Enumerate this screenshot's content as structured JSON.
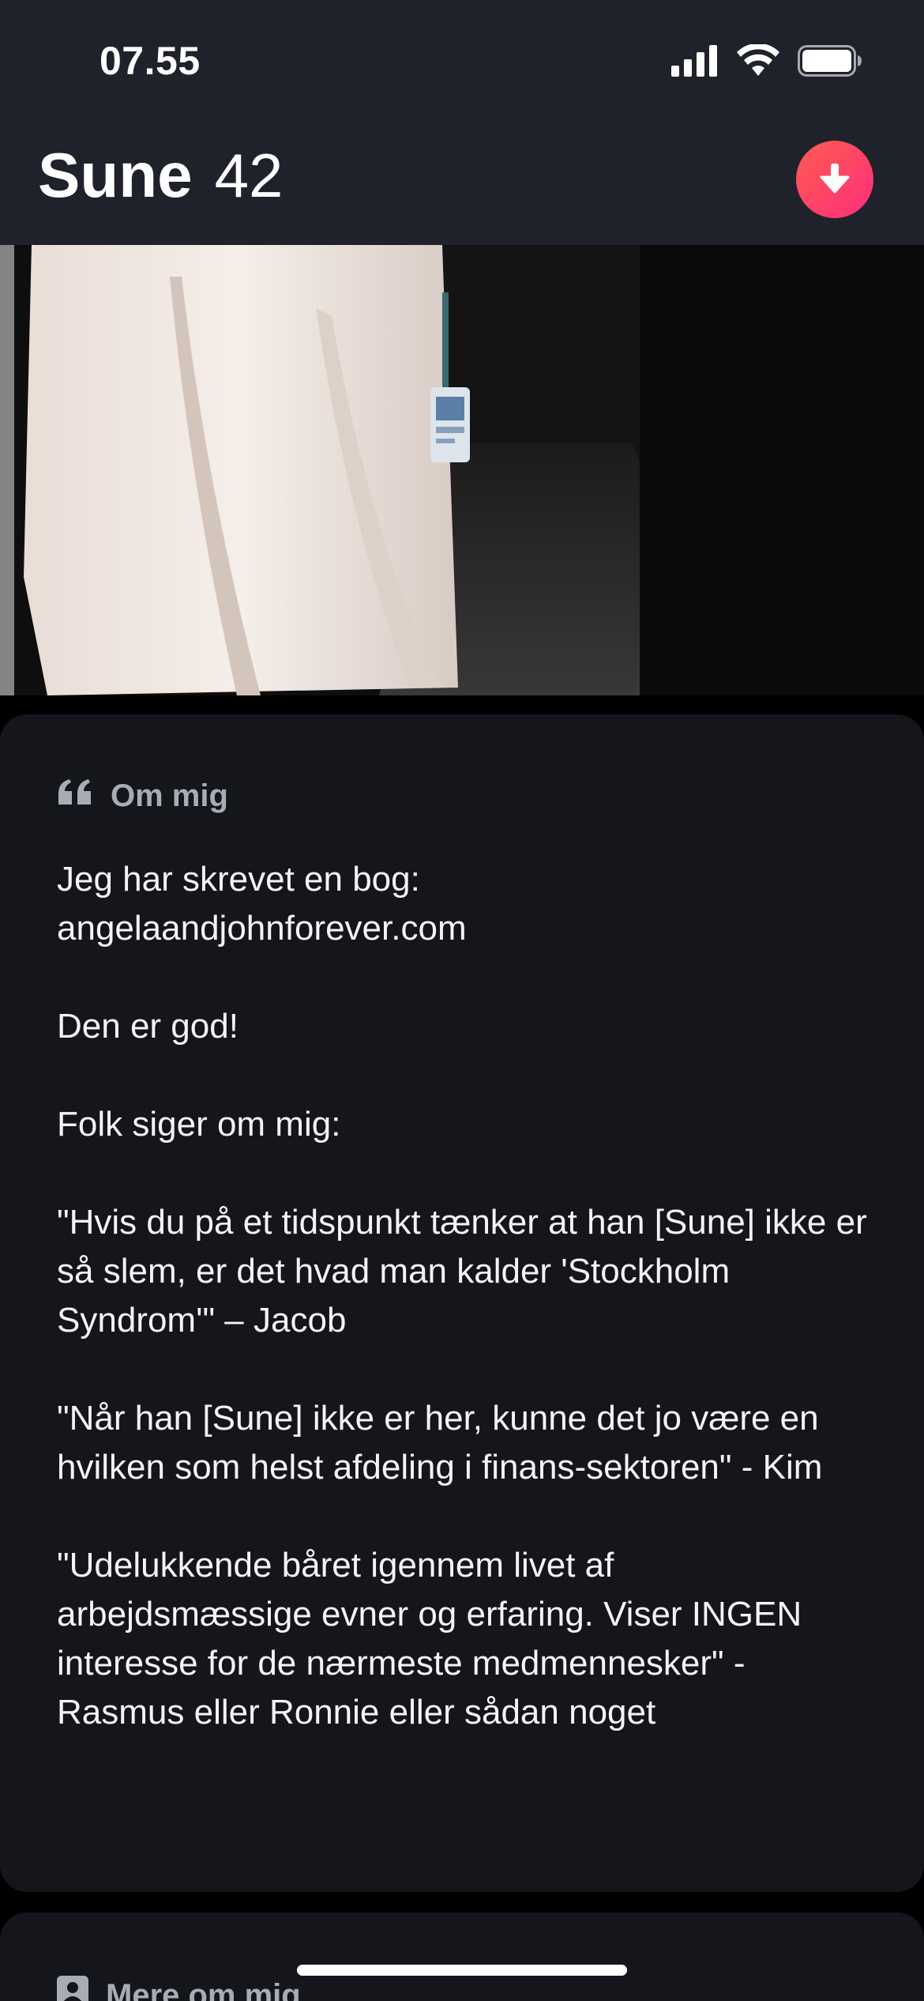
{
  "status_bar": {
    "time": "07.55"
  },
  "header": {
    "name": "Sune",
    "age": "42",
    "collapse_icon": "arrow-down-icon",
    "accent_color": "#fd3f6a"
  },
  "about": {
    "heading": "Om mig",
    "heading_icon": "quote-icon",
    "bio": "Jeg har skrevet en bog:\nangelaandjohnforever.com\n\nDen er god!\n\nFolk siger om mig:\n\n\"Hvis du på et tidspunkt tænker at han [Sune] ikke er så slem, er det hvad man kalder 'Stockholm Syndrom'\" – Jacob\n\n\"Når han [Sune] ikke er her, kunne det jo være en hvilken som helst afdeling i finans-sektoren\" - Kim\n\n\"Udelukkende båret igennem livet af arbejdsmæssige evner og erfaring. Viser INGEN interesse for de nærmeste medmennesker\" - Rasmus eller Ronnie eller sådan noget"
  },
  "more": {
    "heading": "Mere om mig",
    "heading_icon": "profile-card-icon"
  }
}
